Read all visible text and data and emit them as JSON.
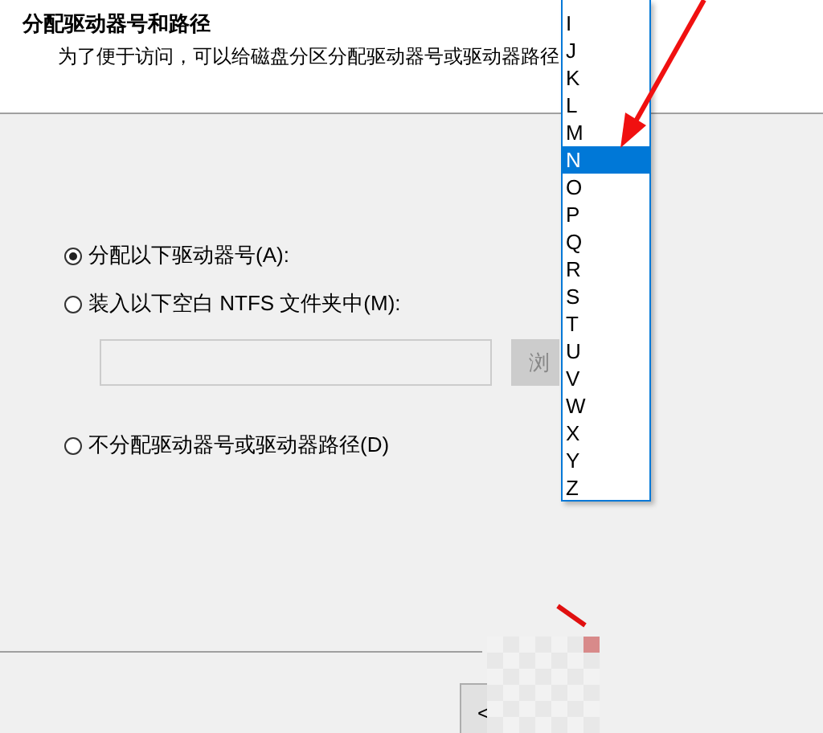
{
  "header": {
    "title": "分配驱动器号和路径",
    "subtitle": "为了便于访问，可以给磁盘分区分配驱动器号或驱动器路径"
  },
  "options": [
    {
      "label": "分配以下驱动器号(A):",
      "selected": true
    },
    {
      "label": "装入以下空白 NTFS 文件夹中(M):",
      "selected": false
    },
    {
      "label": "不分配驱动器号或驱动器路径(D)",
      "selected": false
    }
  ],
  "folder_field": {
    "disabled": true
  },
  "browse_button": {
    "label": "浏",
    "disabled": true
  },
  "drive_letters": [
    {
      "label": "I",
      "selected": false
    },
    {
      "label": "J",
      "selected": false
    },
    {
      "label": "K",
      "selected": false
    },
    {
      "label": "L",
      "selected": false
    },
    {
      "label": "M",
      "selected": false
    },
    {
      "label": "N",
      "selected": true
    },
    {
      "label": "O",
      "selected": false
    },
    {
      "label": "P",
      "selected": false
    },
    {
      "label": "Q",
      "selected": false
    },
    {
      "label": "R",
      "selected": false
    },
    {
      "label": "S",
      "selected": false
    },
    {
      "label": "T",
      "selected": false
    },
    {
      "label": "U",
      "selected": false
    },
    {
      "label": "V",
      "selected": false
    },
    {
      "label": "W",
      "selected": false
    },
    {
      "label": "X",
      "selected": false
    },
    {
      "label": "Y",
      "selected": false
    },
    {
      "label": "Z",
      "selected": false
    }
  ],
  "back_button": {
    "label": "<"
  }
}
